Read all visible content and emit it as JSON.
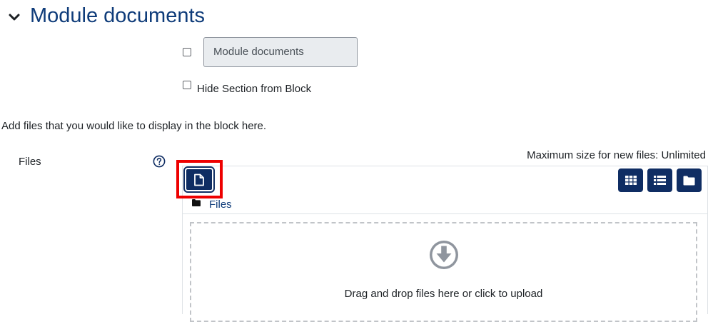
{
  "section": {
    "title": "Module documents"
  },
  "form": {
    "name_value": "Module documents",
    "hide_section_label": "Hide Section from Block",
    "instructions": "Add files that you would like to display in the block here.",
    "files_label": "Files"
  },
  "filepicker": {
    "max_size": "Maximum size for new files: Unlimited",
    "path": "Files",
    "drop_text": "Drag and drop files here or click to upload"
  },
  "colors": {
    "title": "#0f3c7a",
    "button": "#0f2d63",
    "highlight": "#ee0000"
  },
  "icons": [
    "chevron-down-icon",
    "help-icon",
    "file-icon",
    "grid-view-icon",
    "list-view-icon",
    "folder-icon",
    "download-arrow-icon"
  ]
}
